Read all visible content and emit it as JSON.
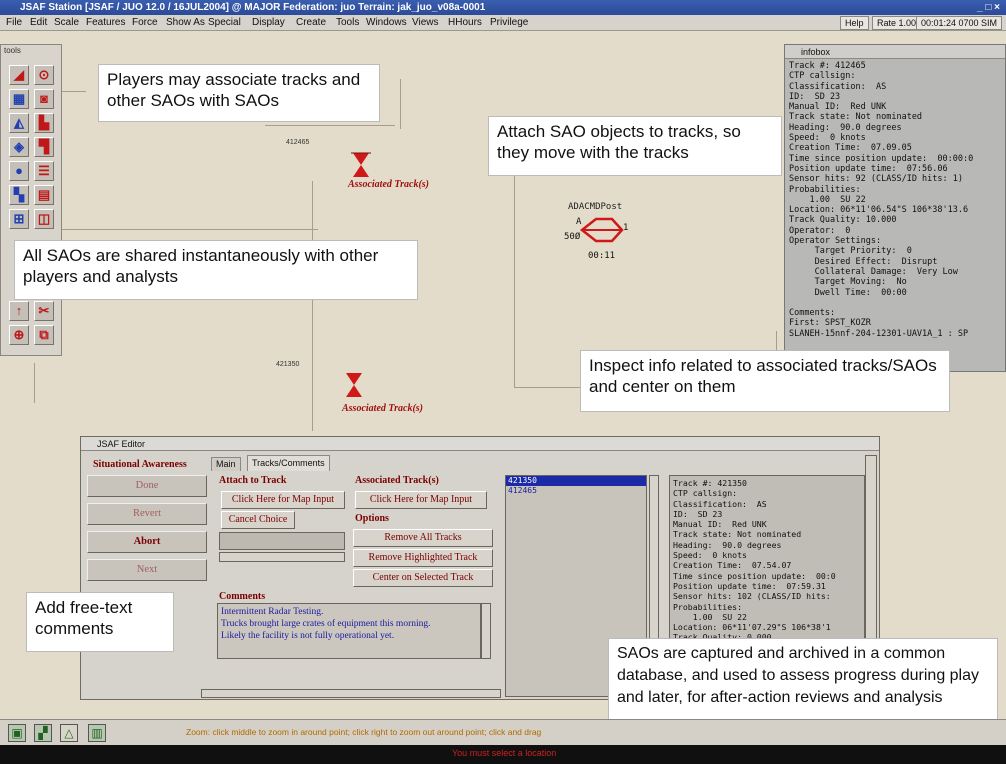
{
  "window": {
    "title": "JSAF Station [JSAF / JUO 12.0 / 16JUL2004] @ MAJOR     Federation: juo     Terrain: jak_juo_v08a-0001",
    "controls": "_ □ ×"
  },
  "menubar": {
    "items": [
      "File",
      "Edit",
      "Scale",
      "Features",
      "Force",
      "Show As",
      "Special",
      "Display",
      "Create",
      "Tools",
      "Windows",
      "Views",
      "HHours",
      "Privilege"
    ],
    "help": "Help",
    "rate": "Rate  1.00",
    "sim_time": "00:01:24 0700 SIM"
  },
  "tools": {
    "title": "tools"
  },
  "map": {
    "track1_id": "412465",
    "track1_label": "Associated Track(s)",
    "track2_id": "421350",
    "track2_label": "Associated Track(s)",
    "sao_name": "ADACMDPost",
    "sao_a": "A",
    "sao_num": "1",
    "sao_range": "50Ø",
    "sao_time": "00:11"
  },
  "callouts": {
    "players": "Players may associate tracks and other SAOs with SAOs",
    "attach": "Attach SAO objects to tracks, so they move with the tracks",
    "shared": "All SAOs are shared instantaneously with other players and analysts",
    "inspect": "Inspect info related to associated tracks/SAOs and center on them",
    "comments": "Add free-text comments",
    "archive": "SAOs are captured and archived in a common database, and used to assess progress during play and later, for after-action reviews and analysis"
  },
  "infobox": {
    "title": "infobox",
    "lines": [
      "Track #: 412465",
      "CTP callsign:",
      "Classification:  AS",
      "ID:  SD 23",
      "Manual ID:  Red UNK",
      "Track state: Not nominated",
      "Heading:  90.0 degrees",
      "Speed:  0 knots",
      "Creation Time:  07.09.05",
      "Time since position update:  00:00:0",
      "Position update time:  07:56.06",
      "Sensor hits: 92 (CLASS/ID hits: 1)",
      "Probabilities:",
      "    1.00  SU 22",
      "Location: 06*11'06.54\"S 106*38'13.6",
      "Track Quality: 10.000",
      "Operator:  0",
      "Operator Settings:",
      "     Target Priority:  0",
      "     Desired Effect:  Disrupt",
      "     Collateral Damage:  Very Low",
      "     Target Moving:  No",
      "     Dwell Time:  00:00",
      "",
      "Comments:",
      "First: SPST_KOZR",
      "SLANEH-15nnf-204-12301-UAV1A_1 : SP"
    ]
  },
  "editor": {
    "title": "JSAF Editor",
    "section": "Situational Awareness",
    "side_buttons": [
      "Done",
      "Revert",
      "Abort",
      "Next"
    ],
    "tabs": [
      "Main",
      "Tracks/Comments"
    ],
    "attach_heading": "Attach to Track",
    "map_input_1": "Click Here for Map Input",
    "cancel_choice": "Cancel Choice",
    "assoc_heading": "Associated Track(s)",
    "map_input_2": "Click Here for Map Input",
    "options_heading": "Options",
    "remove_all": "Remove All Tracks",
    "remove_highlighted": "Remove Highlighted Track",
    "center_selected": "Center on Selected Track",
    "comments_heading": "Comments",
    "comment_lines": [
      "Intermittent Radar Testing.",
      "Trucks brought large crates of equipment this morning.",
      "Likely the facility is not fully operational yet."
    ],
    "track_list": [
      "421350",
      "412465"
    ],
    "detail_lines": [
      "Track #: 421350",
      "CTP callsign:",
      "Classification:  AS",
      "ID:  SD 23",
      "Manual ID:  Red UNK",
      "Track state: Not nominated",
      "Heading:  90.0 degrees",
      "Speed:  0 knots",
      "Creation Time:  07.54.07",
      "Time since position update:  00:0",
      "Position update time:  07:59.31",
      "Sensor hits: 102 (CLASS/ID hits:",
      "Probabilities:",
      "    1.00  SU 22",
      "Location: 06*11'07.29\"S 106*38'1",
      "Track Quality: 0.000"
    ]
  },
  "status": {
    "hint": "Zoom: click middle to zoom in around point; click right to zoom out around point; click and drag",
    "error": "You must select a location"
  }
}
